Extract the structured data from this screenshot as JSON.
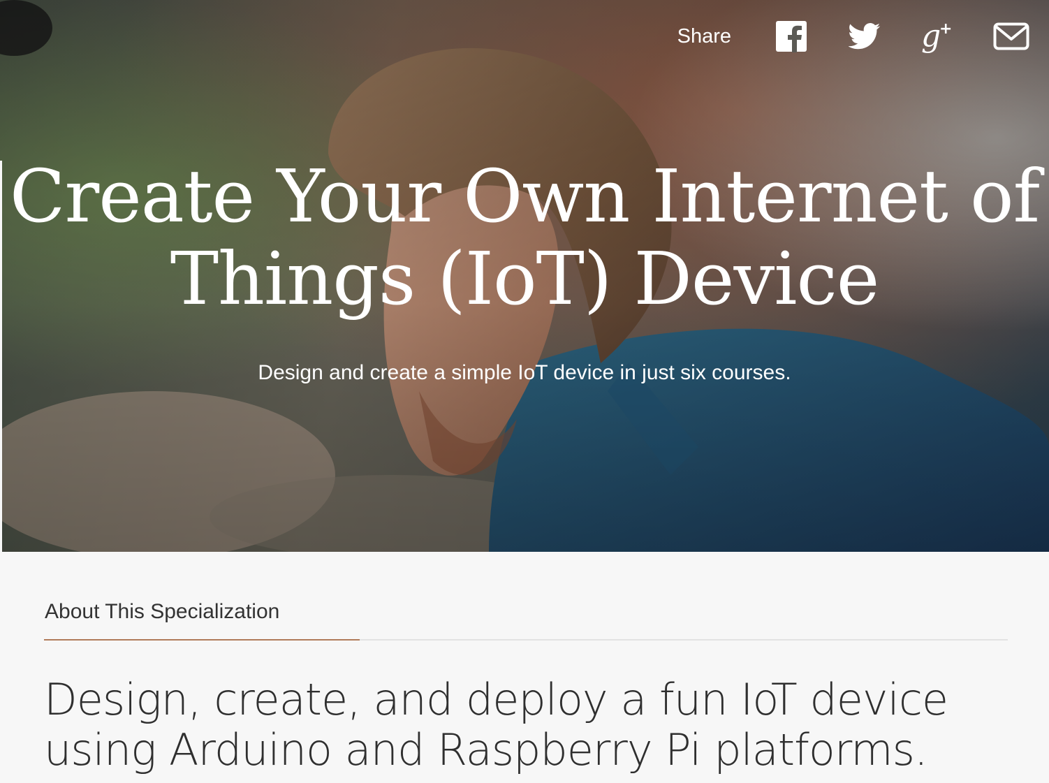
{
  "hero": {
    "title": "Create Your Own Internet of Things (IoT) Device",
    "subtitle": "Design and create a simple IoT device in just six courses.",
    "image": "man-working-at-laptop-photo"
  },
  "share": {
    "label": "Share",
    "icons": [
      "facebook-icon",
      "twitter-icon",
      "google-plus-icon",
      "email-icon"
    ]
  },
  "about": {
    "tab_label": "About This Specialization",
    "headline": "Design, create, and deploy a fun IoT device using Arduino and Raspberry Pi platforms."
  },
  "colors": {
    "accent_rule": "#b07b5a",
    "text_on_image": "#ffffff",
    "section_background": "#f7f7f7",
    "divider": "#e3e3e3"
  }
}
